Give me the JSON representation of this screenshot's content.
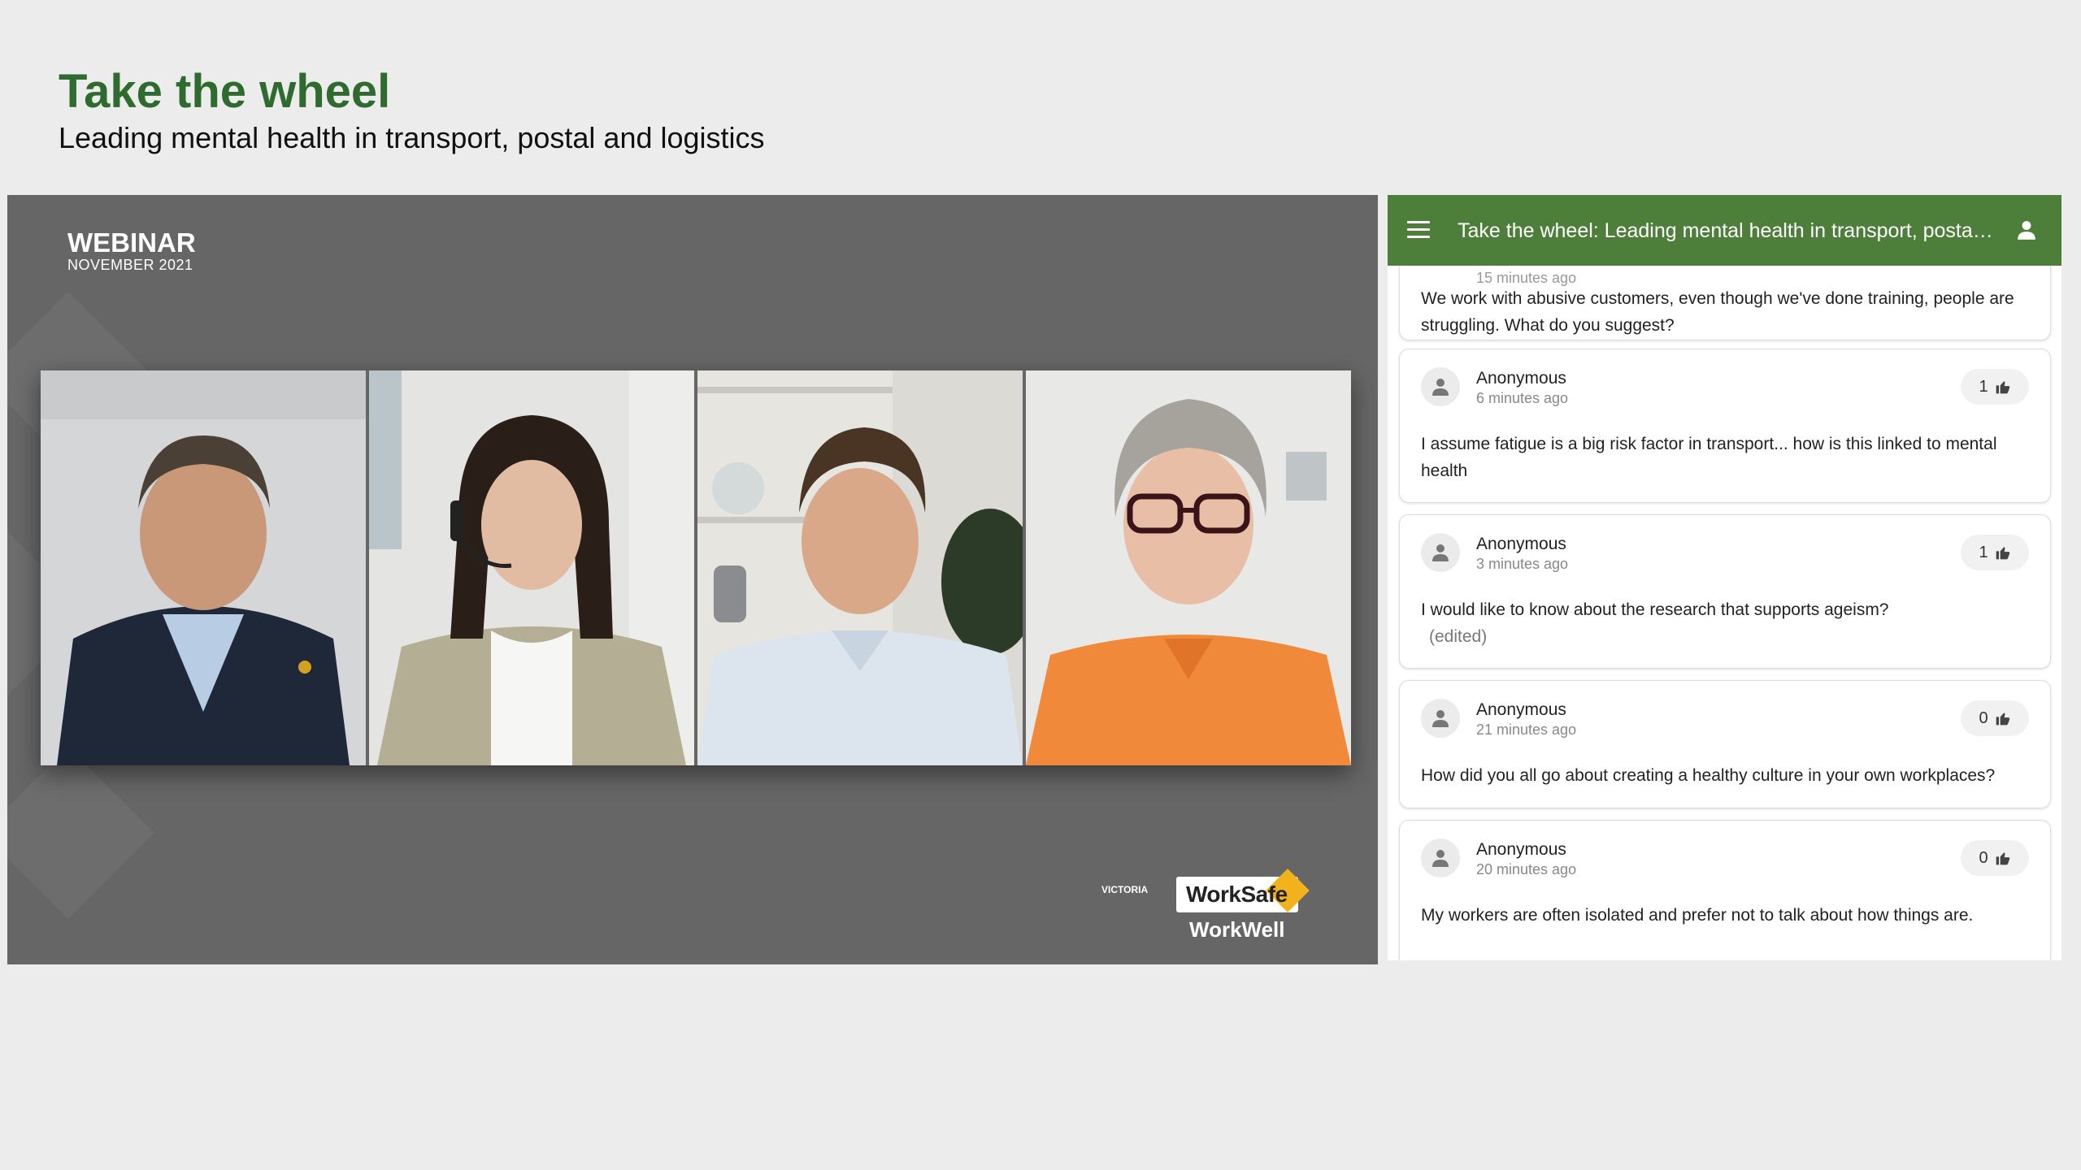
{
  "header": {
    "title": "Take the wheel",
    "subtitle": "Leading mental health in transport, postal and logistics"
  },
  "stage": {
    "webinar_label": "WEBINAR",
    "webinar_date": "NOVEMBER 2021",
    "logos": {
      "victoria": "VICTORIA",
      "worksafe": "WorkSafe",
      "workwell": "WorkWell"
    }
  },
  "qa": {
    "title": "Take the wheel: Leading mental health in transport, postal and logistics",
    "partial_time": "15 minutes ago",
    "first_question": "We work with abusive customers, even though we've done training, people are struggling. What do you suggest?",
    "questions": [
      {
        "author": "Anonymous",
        "time": "6 minutes ago",
        "likes": "1",
        "text": "I assume fatigue is a big risk factor in transport... how is this linked to mental health",
        "edited": ""
      },
      {
        "author": "Anonymous",
        "time": "3 minutes ago",
        "likes": "1",
        "text": "I would like to know about the research that supports ageism?",
        "edited": "(edited)"
      },
      {
        "author": "Anonymous",
        "time": "21 minutes ago",
        "likes": "0",
        "text": "How did you all go about creating a healthy culture in your own workplaces?",
        "edited": ""
      },
      {
        "author": "Anonymous",
        "time": "20 minutes ago",
        "likes": "0",
        "text": "My workers are often isolated and prefer not to talk about how things are.",
        "edited": ""
      }
    ]
  },
  "colors": {
    "accent_green": "#4e7f3a",
    "title_green": "#2f6b2f",
    "stage_grey": "#666666"
  }
}
